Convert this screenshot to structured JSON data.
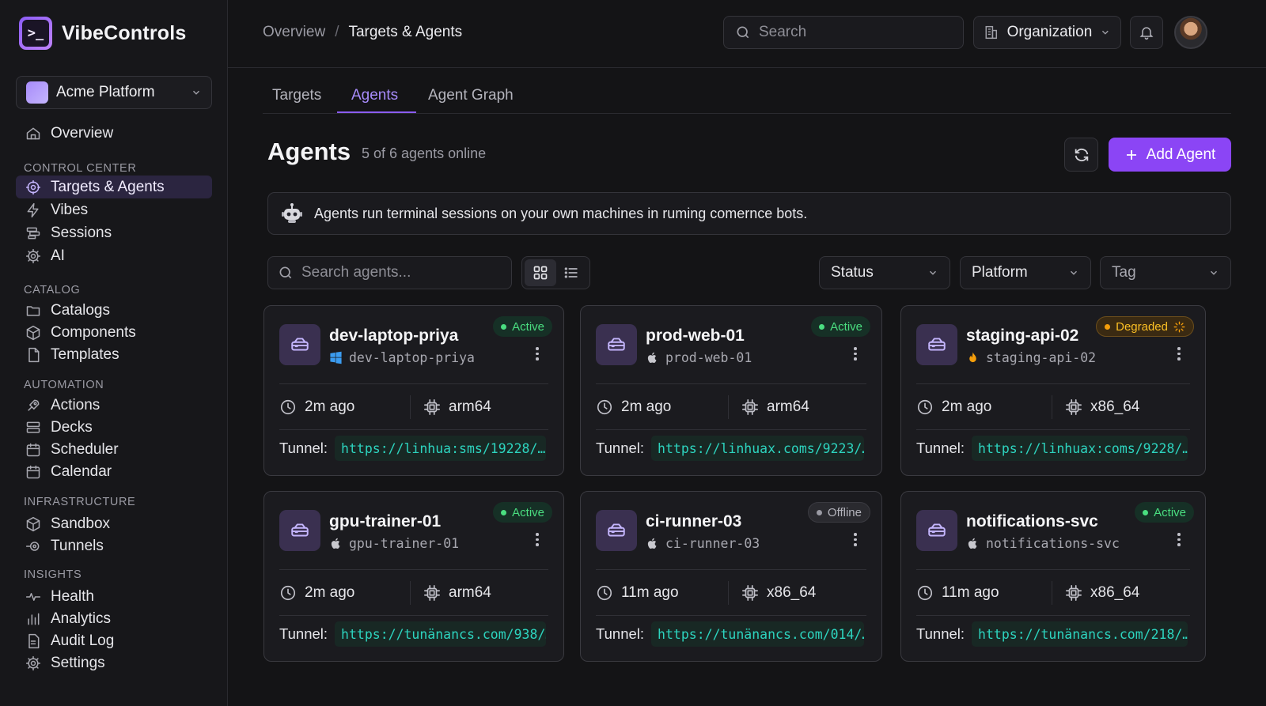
{
  "brand": {
    "name": "VibeControls",
    "logo_glyph": ">_"
  },
  "workspace": {
    "name": "Acme Platform"
  },
  "sidebar": {
    "items": [
      {
        "label": "Overview",
        "icon": "home-icon"
      },
      {
        "section": "CONTROL CENTER"
      },
      {
        "label": "Targets & Agents",
        "icon": "target-icon",
        "active": true
      },
      {
        "label": "Vibes",
        "icon": "bolt-icon"
      },
      {
        "label": "Sessions",
        "icon": "layers-icon"
      },
      {
        "label": "AI",
        "icon": "gear-icon"
      },
      {
        "section": "CATALOG"
      },
      {
        "label": "Catalogs",
        "icon": "folder-icon"
      },
      {
        "label": "Components",
        "icon": "cube-icon"
      },
      {
        "label": "Templates",
        "icon": "file-icon"
      },
      {
        "section": "AUTOMATION"
      },
      {
        "label": "Actions",
        "icon": "rocket-icon"
      },
      {
        "label": "Decks",
        "icon": "stack-icon"
      },
      {
        "label": "Scheduler",
        "icon": "calendar-icon"
      },
      {
        "label": "Calendar",
        "icon": "calendar-icon"
      },
      {
        "section": "INFRASTRUCTURE"
      },
      {
        "label": "Sandbox",
        "icon": "cube-icon"
      },
      {
        "label": "Tunnels",
        "icon": "tunnel-icon"
      },
      {
        "section": "INSIGHTS"
      },
      {
        "label": "Health",
        "icon": "pulse-icon"
      },
      {
        "label": "Analytics",
        "icon": "bar-chart-icon"
      },
      {
        "label": "Audit Log",
        "icon": "document-icon"
      },
      {
        "label": "Settings",
        "icon": "gear-icon"
      }
    ]
  },
  "header": {
    "breadcrumb": {
      "parent": "Overview",
      "separator": "/",
      "current": "Targets & Agents"
    },
    "search_placeholder": "Search",
    "org_label": "Organization"
  },
  "tabs": [
    {
      "label": "Targets"
    },
    {
      "label": "Agents",
      "active": true
    },
    {
      "label": "Agent Graph"
    }
  ],
  "page": {
    "title": "Agents",
    "subtitle": "5 of 6 agents online",
    "add_label": "Add Agent",
    "banner": "Agents run terminal sessions on your own machines in ruming comernce bots."
  },
  "toolbar": {
    "search_placeholder": "Search agents...",
    "filters": {
      "status": "Status",
      "platform": "Platform",
      "tag": "Tag"
    }
  },
  "agents": [
    {
      "name": "dev-laptop-priya",
      "host": "dev-laptop-priya",
      "os": "windows-icon",
      "status": "Active",
      "status_kind": "active",
      "last_seen": "2m ago",
      "arch": "arm64",
      "tunnel_label": "Tunnel:",
      "tunnel": "https://linhua:sms/19228/…"
    },
    {
      "name": "prod-web-01",
      "host": "prod-web-01",
      "os": "apple-icon",
      "status": "Active",
      "status_kind": "active",
      "last_seen": "2m ago",
      "arch": "arm64",
      "tunnel_label": "Tunnel:",
      "tunnel": "https://linhuax.coms/9223/…"
    },
    {
      "name": "staging-api-02",
      "host": "staging-api-02",
      "os": "flame-icon",
      "status": "Degraded",
      "status_kind": "degraded",
      "last_seen": "2m ago",
      "arch": "x86_64",
      "tunnel_label": "Tunnel:",
      "tunnel": "https://linhuax:coms/9228/…"
    },
    {
      "name": "gpu-trainer-01",
      "host": "gpu-trainer-01",
      "os": "apple-icon",
      "status": "Active",
      "status_kind": "active",
      "last_seen": "2m ago",
      "arch": "arm64",
      "tunnel_label": "Tunnel:",
      "tunnel": "https://tunänancs.com/938/…"
    },
    {
      "name": "ci-runner-03",
      "host": "ci-runner-03",
      "os": "apple-icon",
      "status": "Offline",
      "status_kind": "offline",
      "last_seen": "11m ago",
      "arch": "x86_64",
      "tunnel_label": "Tunnel:",
      "tunnel": "https://tunänancs.com/014/…"
    },
    {
      "name": "notifications-svc",
      "host": "notifications-svc",
      "os": "apple-icon",
      "status": "Active",
      "status_kind": "active",
      "last_seen": "11m ago",
      "arch": "x86_64",
      "tunnel_label": "Tunnel:",
      "tunnel": "https://tunänancs.com/218/…"
    }
  ],
  "colors": {
    "accent": "#8b5cf6",
    "active": "#4ade80",
    "degraded": "#f59e0b",
    "offline": "#9a9aa3",
    "tunnel": "#2dd4bf"
  }
}
